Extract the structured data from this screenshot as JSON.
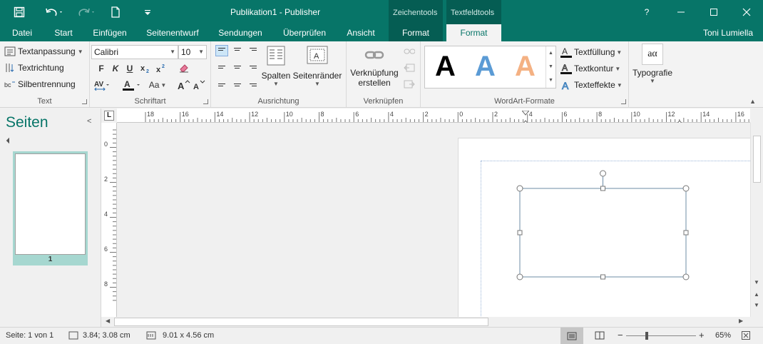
{
  "window": {
    "title": "Publikation1 - Publisher",
    "help": "?"
  },
  "context_groups": {
    "zeichentools": "Zeichentools",
    "textfeldtools": "Textfeldtools"
  },
  "tabs": [
    "Datei",
    "Start",
    "Einfügen",
    "Seitenentwurf",
    "Sendungen",
    "Überprüfen",
    "Ansicht",
    "Format",
    "Format"
  ],
  "user": "Toni Lumiella",
  "ribbon": {
    "text_group": {
      "label": "Text",
      "textanpassung": "Textanpassung",
      "textrichtung": "Textrichtung",
      "silbentrennung": "Silbentrennung"
    },
    "schriftart_group": {
      "label": "Schriftart",
      "font": "Calibri",
      "size": "10",
      "bold": "F",
      "italic": "K",
      "underline": "U",
      "aa": "Aa"
    },
    "ausrichtung_group": {
      "label": "Ausrichtung",
      "spalten": "Spalten",
      "seitenraender": "Seitenränder"
    },
    "verknuepfen_group": {
      "label": "Verknüpfen",
      "verknuepfung": "Verknüpfung",
      "erstellen": "erstellen"
    },
    "wordart_group": {
      "label": "WordArt-Formate",
      "sample": "A",
      "textfuellung": "Textfüllung",
      "textkontur": "Textkontur",
      "texteffekte": "Texteffekte"
    },
    "typografie_group": {
      "label": "Typografie",
      "sample": "aα"
    }
  },
  "pages_pane": {
    "title": "Seiten",
    "page_number": "1"
  },
  "ruler": {
    "h_labels": [
      "18",
      "16",
      "14",
      "12",
      "10",
      "8",
      "6",
      "4",
      "2",
      "0",
      "2",
      "4",
      "6",
      "8",
      "10",
      "12",
      "14",
      "16"
    ],
    "v_labels": [
      "0",
      "2",
      "4",
      "6",
      "8"
    ],
    "corner": "L"
  },
  "status": {
    "page": "Seite: 1 von 1",
    "position": "3.84; 3.08 cm",
    "size": "9.01 x  4.56 cm",
    "zoom": "65%"
  },
  "colors": {
    "brand": "#077568",
    "context": "#055d53",
    "wordart_blue": "#5b9bd5",
    "wordart_orange": "#f4b183"
  }
}
